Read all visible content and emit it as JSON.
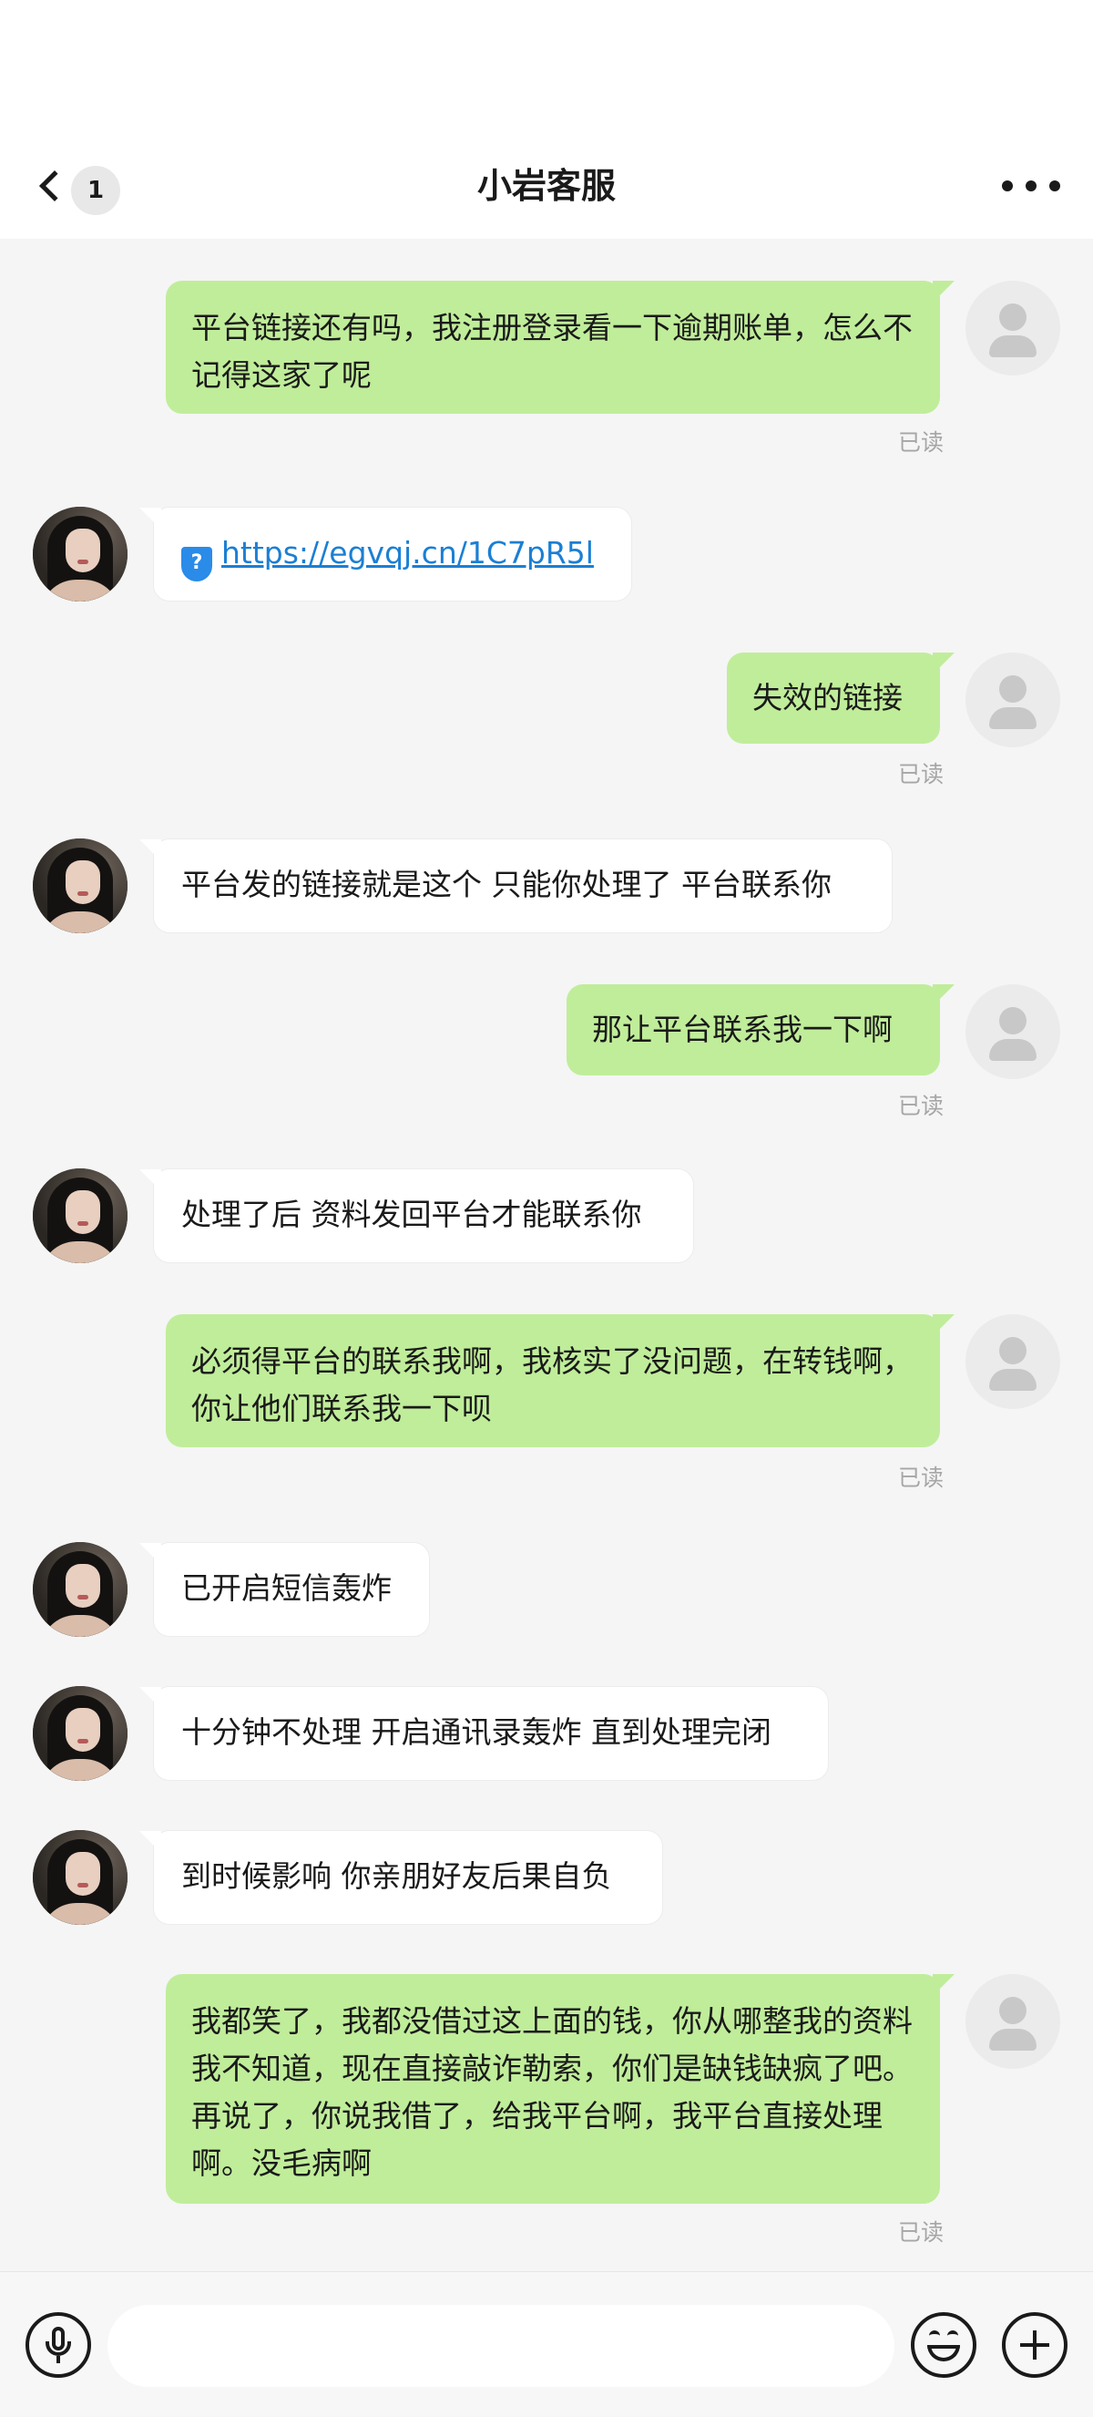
{
  "header": {
    "title": "小岩客服",
    "unread_count": "1"
  },
  "messages": [
    {
      "from": "me",
      "text": "平台链接还有吗，我注册登录看一下逾期账单，怎么不记得这家了呢",
      "status": "已读"
    },
    {
      "from": "agent",
      "link": "https://egvqj.cn/1C7pR5l"
    },
    {
      "from": "me",
      "text": "失效的链接",
      "status": "已读"
    },
    {
      "from": "agent",
      "text": "平台发的链接就是这个 只能你处理了 平台联系你"
    },
    {
      "from": "me",
      "text": "那让平台联系我一下啊",
      "status": "已读"
    },
    {
      "from": "agent",
      "text": "处理了后 资料发回平台才能联系你"
    },
    {
      "from": "me",
      "text": "必须得平台的联系我啊，我核实了没问题，在转钱啊，你让他们联系我一下呗",
      "status": "已读"
    },
    {
      "from": "agent",
      "text": "已开启短信轰炸"
    },
    {
      "from": "agent",
      "text": "十分钟不处理 开启通讯录轰炸 直到处理完闭"
    },
    {
      "from": "agent",
      "text": "到时候影响 你亲朋好友后果自负"
    },
    {
      "from": "me",
      "text": "我都笑了，我都没借过这上面的钱，你从哪整我的资料我不知道，现在直接敲诈勒索，你们是缺钱缺疯了吧。再说了，你说我借了，给我平台啊，我平台直接处理啊。没毛病啊",
      "status": "已读"
    }
  ],
  "input": {
    "value": "",
    "placeholder": ""
  },
  "icons": {
    "back": "chevron-left-icon",
    "more": "more-dots-icon",
    "voice": "microphone-icon",
    "emoji": "emoji-icon",
    "attach": "plus-icon",
    "link_safe": "shield-question-icon",
    "self_avatar": "default-user-avatar",
    "agent_avatar": "agent-photo-avatar"
  },
  "colors": {
    "self_bubble": "#c0ed9a",
    "other_bubble": "#ffffff",
    "link": "#1b7fd4",
    "read_status": "#a6a6a6",
    "chat_bg": "#f5f5f5"
  }
}
